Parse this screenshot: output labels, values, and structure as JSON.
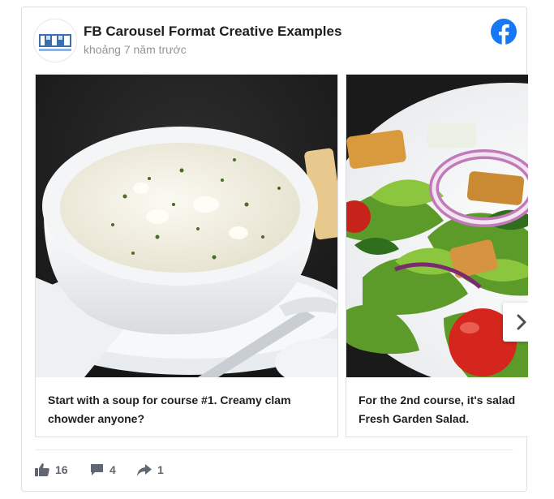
{
  "post": {
    "title": "FB Carousel Format Creative Examples",
    "timestamp": "khoảng 7 năm trước"
  },
  "carousel": {
    "cards": [
      {
        "caption": "Start with a soup for course #1. Creamy clam chowder anyone?"
      },
      {
        "caption": "For the 2nd course, it's salad Fresh Garden Salad."
      }
    ],
    "next_icon": "chevron-right-icon"
  },
  "stats": {
    "likes": "16",
    "comments": "4",
    "shares": "1"
  },
  "colors": {
    "facebook_blue": "#1877f2",
    "text": "#1c1e21",
    "muted": "#90949c"
  }
}
